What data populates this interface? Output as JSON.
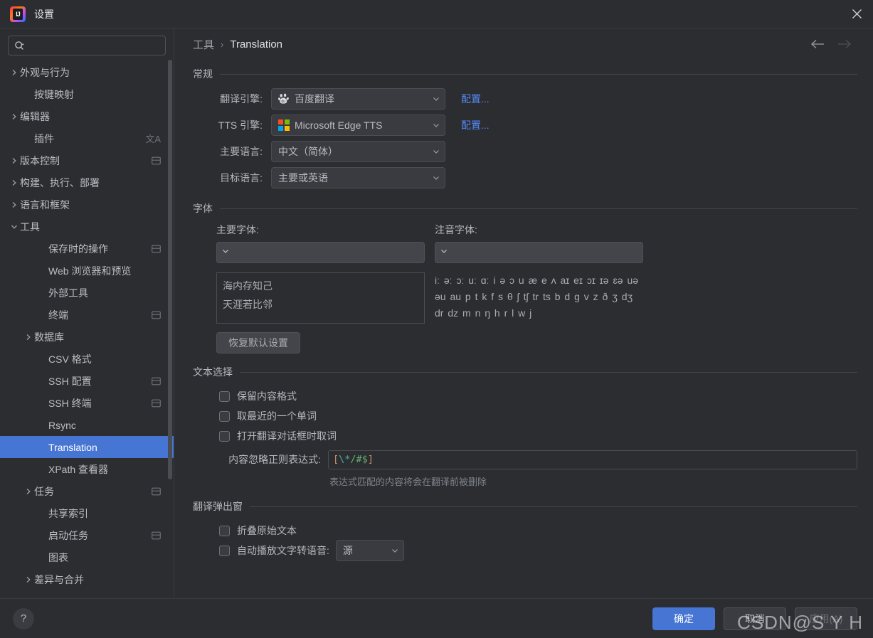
{
  "window": {
    "title": "设置",
    "logo_text": "IJ",
    "close_icon": "close-icon"
  },
  "sidebar": {
    "search": {
      "value": "",
      "placeholder": "",
      "icon": "search-icon"
    },
    "items": [
      {
        "label": "外观与行为",
        "indent": 0,
        "arrow": "right",
        "trail": ""
      },
      {
        "label": "按键映射",
        "indent": 1,
        "arrow": "none",
        "trail": ""
      },
      {
        "label": "编辑器",
        "indent": 0,
        "arrow": "right",
        "trail": ""
      },
      {
        "label": "插件",
        "indent": 1,
        "arrow": "none",
        "trail": "translate"
      },
      {
        "label": "版本控制",
        "indent": 0,
        "arrow": "right",
        "trail": "project"
      },
      {
        "label": "构建、执行、部署",
        "indent": 0,
        "arrow": "right",
        "trail": ""
      },
      {
        "label": "语言和框架",
        "indent": 0,
        "arrow": "right",
        "trail": ""
      },
      {
        "label": "工具",
        "indent": 0,
        "arrow": "down",
        "trail": ""
      },
      {
        "label": "保存时的操作",
        "indent": 2,
        "arrow": "none",
        "trail": "project"
      },
      {
        "label": "Web 浏览器和预览",
        "indent": 2,
        "arrow": "none",
        "trail": ""
      },
      {
        "label": "外部工具",
        "indent": 2,
        "arrow": "none",
        "trail": ""
      },
      {
        "label": "终端",
        "indent": 2,
        "arrow": "none",
        "trail": "project"
      },
      {
        "label": "数据库",
        "indent": 1,
        "arrow": "right",
        "trail": ""
      },
      {
        "label": "CSV 格式",
        "indent": 2,
        "arrow": "none",
        "trail": ""
      },
      {
        "label": "SSH 配置",
        "indent": 2,
        "arrow": "none",
        "trail": "project"
      },
      {
        "label": "SSH 终端",
        "indent": 2,
        "arrow": "none",
        "trail": "project"
      },
      {
        "label": "Rsync",
        "indent": 2,
        "arrow": "none",
        "trail": ""
      },
      {
        "label": "Translation",
        "indent": 2,
        "arrow": "none",
        "trail": "",
        "selected": true
      },
      {
        "label": "XPath 查看器",
        "indent": 2,
        "arrow": "none",
        "trail": ""
      },
      {
        "label": "任务",
        "indent": 1,
        "arrow": "right",
        "trail": "project"
      },
      {
        "label": "共享索引",
        "indent": 2,
        "arrow": "none",
        "trail": ""
      },
      {
        "label": "启动任务",
        "indent": 2,
        "arrow": "none",
        "trail": "project"
      },
      {
        "label": "图表",
        "indent": 2,
        "arrow": "none",
        "trail": ""
      },
      {
        "label": "差异与合并",
        "indent": 1,
        "arrow": "right",
        "trail": ""
      }
    ]
  },
  "breadcrumb": {
    "parent": "工具",
    "separator": "›",
    "current": "Translation",
    "back_icon": "arrow-left-icon",
    "forward_icon": "arrow-right-icon"
  },
  "general": {
    "title": "常规",
    "rows": [
      {
        "label": "翻译引擎:",
        "value": "百度翻译",
        "icon": "baidu-icon",
        "link": "配置..."
      },
      {
        "label": "TTS 引擎:",
        "value": "Microsoft Edge TTS",
        "icon": "microsoft-icon",
        "link": "配置..."
      },
      {
        "label": "主要语言:",
        "value": "中文（简体）",
        "icon": "",
        "link": ""
      },
      {
        "label": "目标语言:",
        "value": "主要或英语",
        "icon": "",
        "link": ""
      }
    ]
  },
  "font": {
    "title": "字体",
    "primary_label": "主要字体:",
    "primary_value": "",
    "phonetic_label": "注音字体:",
    "phonetic_value": "",
    "preview_line1": "海内存知己",
    "preview_line2": "天涯若比邻",
    "phonetic_sample": "iː əː ɔː uː ɑː i ə ɔ u æ e ʌ aɪ eɪ ɔɪ ɪə ɛə uə əu au p t k f s θ ʃ tʃ tr ts b d g v z ð ʒ dʒ dr dz m n ŋ h r l w j",
    "restore_button": "恢复默认设置"
  },
  "text_selection": {
    "title": "文本选择",
    "checkboxes": [
      {
        "label": "保留内容格式",
        "checked": false
      },
      {
        "label": "取最近的一个单词",
        "checked": false
      },
      {
        "label": "打开翻译对话框时取词",
        "checked": false
      }
    ],
    "regex_label": "内容忽略正则表达式:",
    "regex_value": "[\\*/#$]",
    "regex_tokens": [
      {
        "t": "[",
        "k": "bracket"
      },
      {
        "t": "\\*",
        "k": "escape"
      },
      {
        "t": "/",
        "k": "char"
      },
      {
        "t": "#",
        "k": "char"
      },
      {
        "t": "$",
        "k": "char"
      },
      {
        "t": "]",
        "k": "bracket"
      }
    ],
    "hint": "表达式匹配的内容将会在翻译前被删除"
  },
  "popup": {
    "title": "翻译弹出窗",
    "fold_checkbox": {
      "label": "折叠原始文本",
      "checked": false
    },
    "tts_checkbox": {
      "label": "自动播放文字转语音:",
      "checked": false
    },
    "tts_select_value": "源"
  },
  "footer": {
    "help_icon": "help-icon",
    "ok": "确定",
    "cancel": "取消",
    "apply": "应用(A)"
  },
  "watermark": "CSDN@S Y H",
  "colors": {
    "accent": "#4775d3",
    "link": "#548af7",
    "bg": "#2b2d30",
    "panel": "#393b40",
    "text": "#b4b7bd"
  }
}
